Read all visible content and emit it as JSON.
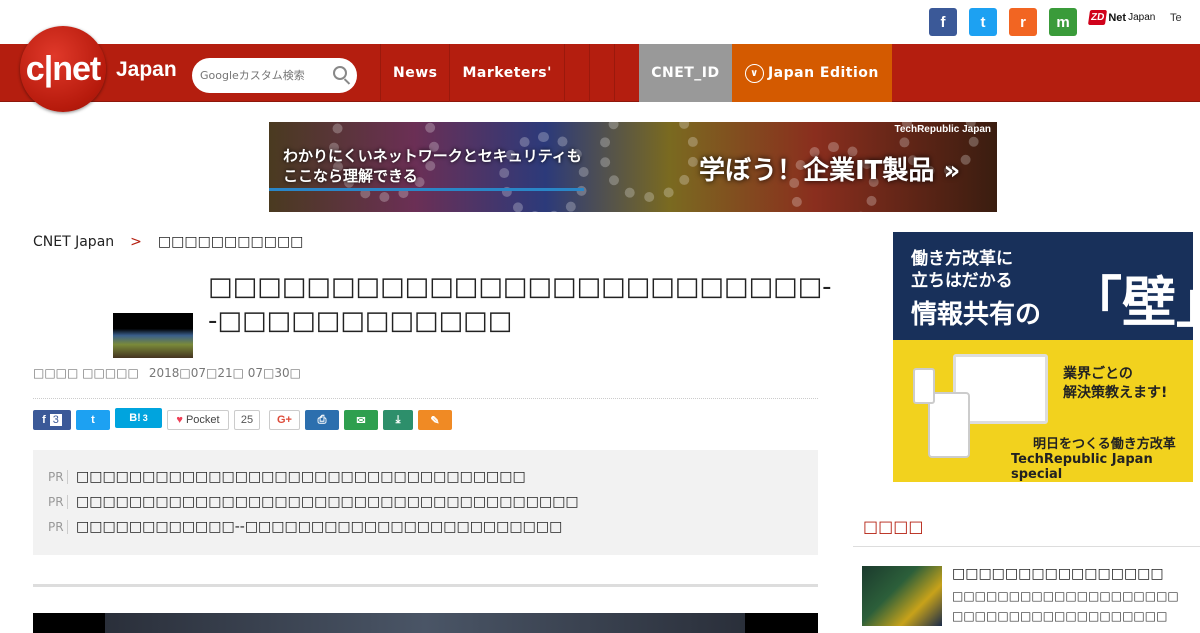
{
  "social": {
    "facebook": "f",
    "twitter": "t",
    "rss": "r",
    "mail": "m",
    "zd_brand": "ZD",
    "zd_net": "Net",
    "zd_japan": "Japan",
    "te": "Te"
  },
  "header": {
    "logo": "c|net",
    "logo_edition": "Japan",
    "search_placeholder": "Googleカスタム検索",
    "nav": [
      {
        "label": "News"
      },
      {
        "label": "Marketers'"
      },
      {
        "label": "CNET_ID"
      },
      {
        "label": "Japan Edition"
      }
    ]
  },
  "banner": {
    "line1": "わかりにくいネットワークとセキュリティも",
    "line2": "ここなら理解できる",
    "headline": "学ぼう！企業IT製品 »",
    "brand": "TechRepublic Japan"
  },
  "breadcrumb": {
    "home": "CNET Japan",
    "sep": ">",
    "section": "□□□□□□□□□□□"
  },
  "article": {
    "title": "□□□□□□□□□□□□□□□□□□□□□□□□□--□□□□□□□□□□□□",
    "author": "□□□□ □□□□□",
    "date": "2018□07□21□ 07□30□"
  },
  "share": {
    "fb_count": "3",
    "hatena_label": "B!",
    "hatena_count": "3",
    "pocket_label": "Pocket",
    "pocket_count": "25",
    "gplus_label": "G+"
  },
  "pr": {
    "tag": "PR",
    "items": [
      "□□□□□□□□□□□□□□□□□□□□□□□□□□□□□□□□□□",
      "□□□□□□□□□□□□□□□□□□□□□□□□□□□□□□□□□□□□□□",
      "□□□□□□□□□□□□--□□□□□□□□□□□□□□□□□□□□□□□□"
    ]
  },
  "sidebar_ad": {
    "line1": "働き方改革に",
    "line2": "立ちはだかる",
    "line3": "情報共有の",
    "wall": "「壁」",
    "point1": "業界ごとの",
    "point2": "解決策教えます!",
    "foot1": "明日をつくる働き方改革",
    "foot2": "TechRepublic Japan special"
  },
  "sidebar": {
    "heading": "□□□□",
    "item_title": "□□□□□□□□□□□□□□□□",
    "item_line1": "□□□□□□□□□□□□□□□□□□□□",
    "item_line2": "□□□□□□□□□□□□□□□□□□□"
  }
}
